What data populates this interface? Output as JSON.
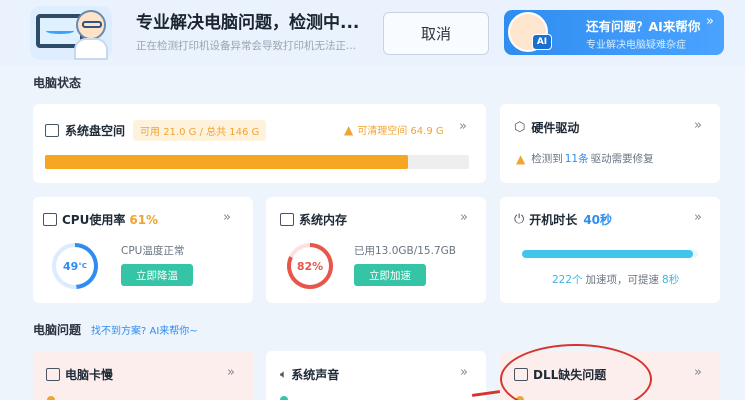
{
  "header": {
    "title": "专业解决电脑问题，检测中...",
    "subtitle": "正在检测打印机设备异常会导致打印机无法正...",
    "cancel_label": "取消",
    "ai_title": "还有问题？AI来帮你",
    "ai_subtitle": "专业解决电脑疑难杂症",
    "ai_badge": "AI"
  },
  "status_section": {
    "title": "电脑状态"
  },
  "disk": {
    "title": "系统盘空间",
    "usage_tag": "可用 21.0 G / 总共 146 G",
    "cleanable": "可清理空间 64.9 G",
    "used_fraction": 0.856
  },
  "driver": {
    "title": "硬件驱动",
    "detected_prefix": "检测到",
    "count": "11条",
    "detected_suffix": "驱动需要修复"
  },
  "cpu": {
    "title": "CPU使用率",
    "percent": "61%",
    "temp_value": "49",
    "temp_unit": "°C",
    "temp_status": "CPU温度正常",
    "button": "立即降温",
    "temp_fraction": 0.49
  },
  "memory": {
    "title": "系统内存",
    "percent": "82%",
    "usage": "已用13.0GB/15.7GB",
    "button": "立即加速",
    "used_fraction": 0.82
  },
  "uptime": {
    "title": "开机时长",
    "value": "40秒",
    "startup_count": "222个",
    "startup_mid": "加速项，可提速",
    "speedup": "8秒",
    "bar_fraction": 0.97
  },
  "problems_section": {
    "title": "电脑问题",
    "hint": "找不到方案? AI来帮你~"
  },
  "problems": [
    {
      "title": "电脑卡慢"
    },
    {
      "title": "系统声音"
    },
    {
      "title": "DLL缺失问题"
    }
  ],
  "chevron": "»",
  "colors": {
    "accent_blue": "#2f8df0",
    "orange": "#f0a431",
    "teal": "#35c5a6",
    "cyan": "#3fc6ea",
    "red_ring": "#e8554a",
    "annotation_red": "#d8342e"
  }
}
